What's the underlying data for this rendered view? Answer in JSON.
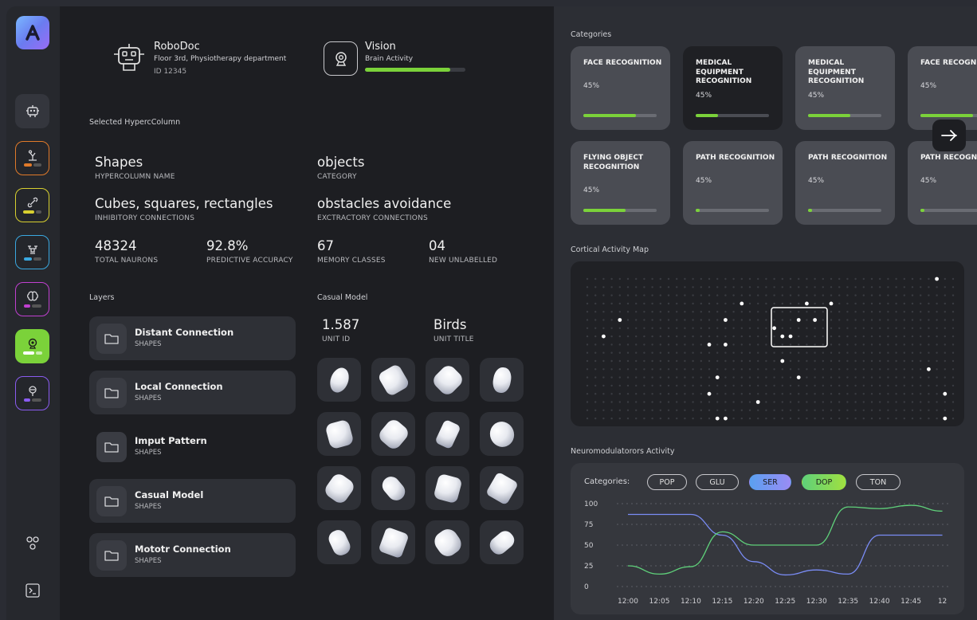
{
  "device": {
    "name": "RoboDoc",
    "location": "Floor 3rd, Physiotherapy department",
    "id": "ID 12345"
  },
  "vision": {
    "title": "Vision",
    "subtitle": "Brain Activity",
    "progress": 0.85
  },
  "selected_section": "Selected HypercColumn",
  "stats": [
    {
      "value": "Shapes",
      "label": "HYPERCOLUMN NAME"
    },
    {
      "value": "objects",
      "label": "CATEGORY"
    },
    {
      "value": "Cubes, squares, rectangles",
      "label": "INHIBITORY CONNECTIONS"
    },
    {
      "value": "obstacles avoidance",
      "label": "EXCTRACTORY CONNECTIONS"
    },
    {
      "value": "48324",
      "label": "TOTAL NAURONS"
    },
    {
      "value": "92.8%",
      "label": "PREDICTIVE ACCURACY"
    },
    {
      "value": "67",
      "label": "MEMORY CLASSES"
    },
    {
      "value": "04",
      "label": "NEW UNLABELLED"
    }
  ],
  "layers_title": "Layers",
  "layers": [
    {
      "name": "Distant Connection",
      "type": "SHAPES"
    },
    {
      "name": "Local Connection",
      "type": "SHAPES"
    },
    {
      "name": "Imput Pattern",
      "type": "SHAPES"
    },
    {
      "name": "Casual Model",
      "type": "SHAPES"
    },
    {
      "name": "Mototr Connection",
      "type": "SHAPES"
    }
  ],
  "casual_model": {
    "title": "Casual Model",
    "unit_id": "1.587",
    "unit_id_label": "UNIT ID",
    "unit_title": "Birds",
    "unit_title_label": "UNIT TITLE"
  },
  "categories_title": "Categories",
  "categories": [
    {
      "title": "FACE RECOGNITION",
      "percent": "45%",
      "fill": 0.72
    },
    {
      "title": "MEDICAL EQUIPMENT RECOGNITION",
      "percent": "45%",
      "fill": 0.3
    },
    {
      "title": "MEDICAL EQUIPMENT RECOGNITION",
      "percent": "45%",
      "fill": 0.58
    },
    {
      "title": "FACE RECOGNITION",
      "percent": "45%",
      "fill": 0.72
    },
    {
      "title": "FLYING OBJECT RECOGNITION",
      "percent": "45%",
      "fill": 0.58
    },
    {
      "title": "PATH RECOGNITION",
      "percent": "45%",
      "fill": 0.05
    },
    {
      "title": "PATH RECOGNITION",
      "percent": "45%",
      "fill": 0.05
    },
    {
      "title": "PATH RECOGNITION",
      "percent": "45%",
      "fill": 0.05
    }
  ],
  "map_title": "Cortical Activity Map",
  "neuro_title": "Neuromodulatorors Activity",
  "filter_label": "Categories:",
  "filters": [
    "POP",
    "GLU",
    "SER",
    "DOP",
    "TON"
  ],
  "colors": {
    "accent_green": "#7bd23a",
    "ser": "#7a8cf5",
    "dop": "#5fd07a"
  },
  "chart_data": {
    "type": "line",
    "x": [
      "12:00",
      "12:05",
      "12:10",
      "12:15",
      "12:20",
      "12:25",
      "12:30",
      "12:35",
      "12:40",
      "12:45",
      "12"
    ],
    "y_ticks": [
      "100",
      "75",
      "50",
      "25",
      "0"
    ],
    "ylim": [
      0,
      100
    ],
    "series": [
      {
        "name": "SER",
        "color": "#7a8cf5",
        "values": [
          87,
          87,
          87,
          62,
          30,
          14,
          20,
          15,
          62,
          62,
          62
        ]
      },
      {
        "name": "DOP",
        "color": "#5fd07a",
        "values": [
          25,
          15,
          24,
          66,
          50,
          50,
          50,
          96,
          94,
          98,
          91
        ]
      }
    ]
  }
}
